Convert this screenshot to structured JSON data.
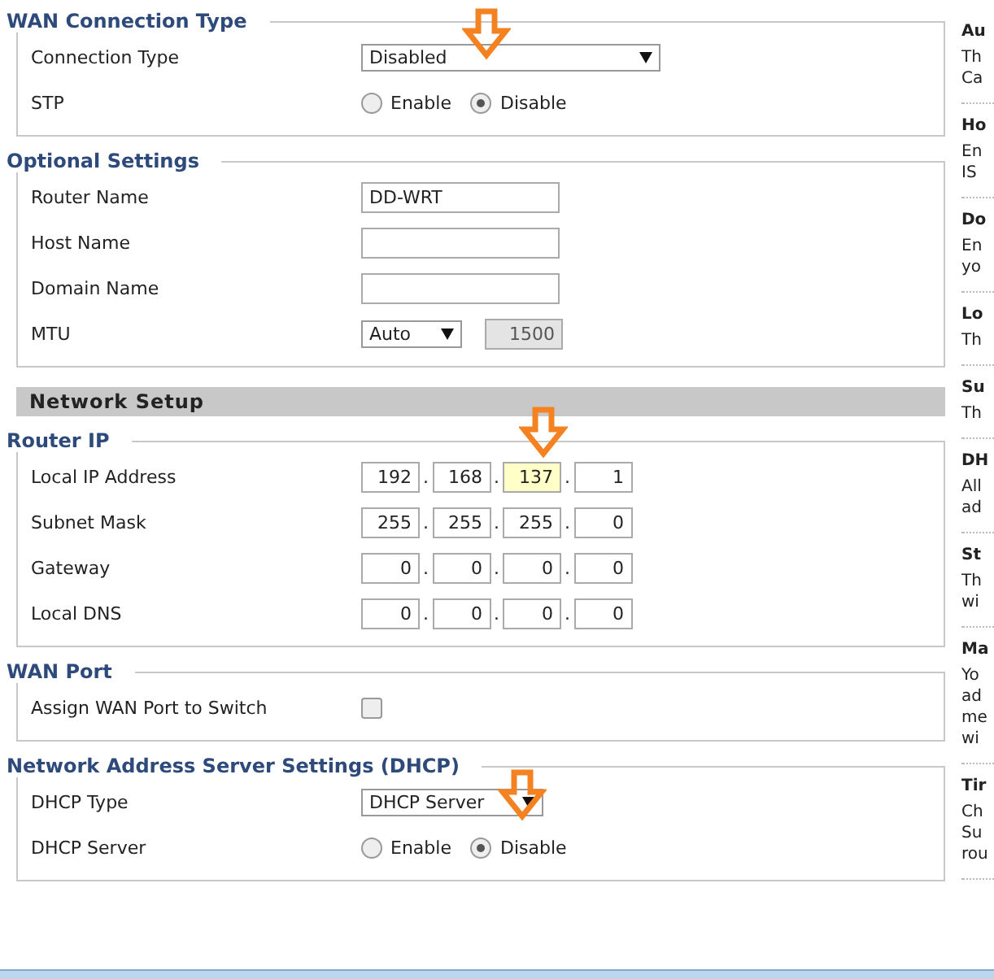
{
  "sections": [
    {
      "kind": "fieldset",
      "title": "WAN Connection Type",
      "rows": [
        {
          "kind": "select",
          "label": "Connection Type",
          "value": "Disabled",
          "wide": true,
          "arrow": true
        },
        {
          "kind": "radio",
          "label": "STP",
          "options": [
            {
              "label": "Enable",
              "selected": false
            },
            {
              "label": "Disable",
              "selected": true
            }
          ]
        }
      ]
    },
    {
      "kind": "fieldset",
      "title": "Optional Settings",
      "rows": [
        {
          "kind": "text",
          "label": "Router Name",
          "value": "DD-WRT"
        },
        {
          "kind": "text",
          "label": "Host Name",
          "value": ""
        },
        {
          "kind": "text",
          "label": "Domain Name",
          "value": ""
        },
        {
          "kind": "mtu",
          "label": "MTU",
          "value": "Auto",
          "number": "1500",
          "disabled": true
        }
      ]
    },
    {
      "kind": "bar",
      "title": "Network Setup"
    },
    {
      "kind": "fieldset",
      "title": "Router IP",
      "rows": [
        {
          "kind": "ip",
          "label": "Local IP Address",
          "separator": ".",
          "octets": [
            {
              "value": "192",
              "highlighted": false
            },
            {
              "value": "168",
              "highlighted": false
            },
            {
              "value": "137",
              "highlighted": true,
              "arrow": true
            },
            {
              "value": "1",
              "highlighted": false
            }
          ]
        },
        {
          "kind": "ip",
          "label": "Subnet Mask",
          "separator": ".",
          "octets": [
            {
              "value": "255",
              "highlighted": false
            },
            {
              "value": "255",
              "highlighted": false
            },
            {
              "value": "255",
              "highlighted": false
            },
            {
              "value": "0",
              "highlighted": false
            }
          ]
        },
        {
          "kind": "ip",
          "label": "Gateway",
          "separator": ".",
          "octets": [
            {
              "value": "0",
              "highlighted": false
            },
            {
              "value": "0",
              "highlighted": false
            },
            {
              "value": "0",
              "highlighted": false
            },
            {
              "value": "0",
              "highlighted": false
            }
          ]
        },
        {
          "kind": "ip",
          "label": "Local DNS",
          "separator": ".",
          "octets": [
            {
              "value": "0",
              "highlighted": false
            },
            {
              "value": "0",
              "highlighted": false
            },
            {
              "value": "0",
              "highlighted": false
            },
            {
              "value": "0",
              "highlighted": false
            }
          ]
        }
      ]
    },
    {
      "kind": "fieldset",
      "title": "WAN Port",
      "rows": [
        {
          "kind": "checkbox",
          "label": "Assign WAN Port to Switch",
          "checked": false
        }
      ]
    },
    {
      "kind": "fieldset",
      "title": "Network Address Server Settings (DHCP)",
      "rows": [
        {
          "kind": "select",
          "label": "DHCP Type",
          "value": "DHCP Server",
          "wide": false,
          "arrow": true
        },
        {
          "kind": "radio",
          "label": "DHCP Server",
          "options": [
            {
              "label": "Enable",
              "selected": false
            },
            {
              "label": "Disable",
              "selected": true
            }
          ]
        }
      ]
    }
  ],
  "help": [
    {
      "title": "Au",
      "lines": [
        "Th",
        "Ca"
      ]
    },
    {
      "title": "Ho",
      "lines": [
        "En",
        "IS"
      ]
    },
    {
      "title": "Do",
      "lines": [
        "En",
        "yo"
      ]
    },
    {
      "title": "Lo",
      "lines": [
        "Th"
      ]
    },
    {
      "title": "Su",
      "lines": [
        "Th"
      ]
    },
    {
      "title": "DH",
      "lines": [
        "All",
        "ad"
      ]
    },
    {
      "title": "St",
      "lines": [
        "Th",
        "wi"
      ]
    },
    {
      "title": "Ma",
      "lines": [
        "Yo",
        "ad",
        "me",
        "wi"
      ]
    },
    {
      "title": "Tir",
      "lines": [
        "Ch",
        "Su",
        "rou"
      ]
    }
  ]
}
